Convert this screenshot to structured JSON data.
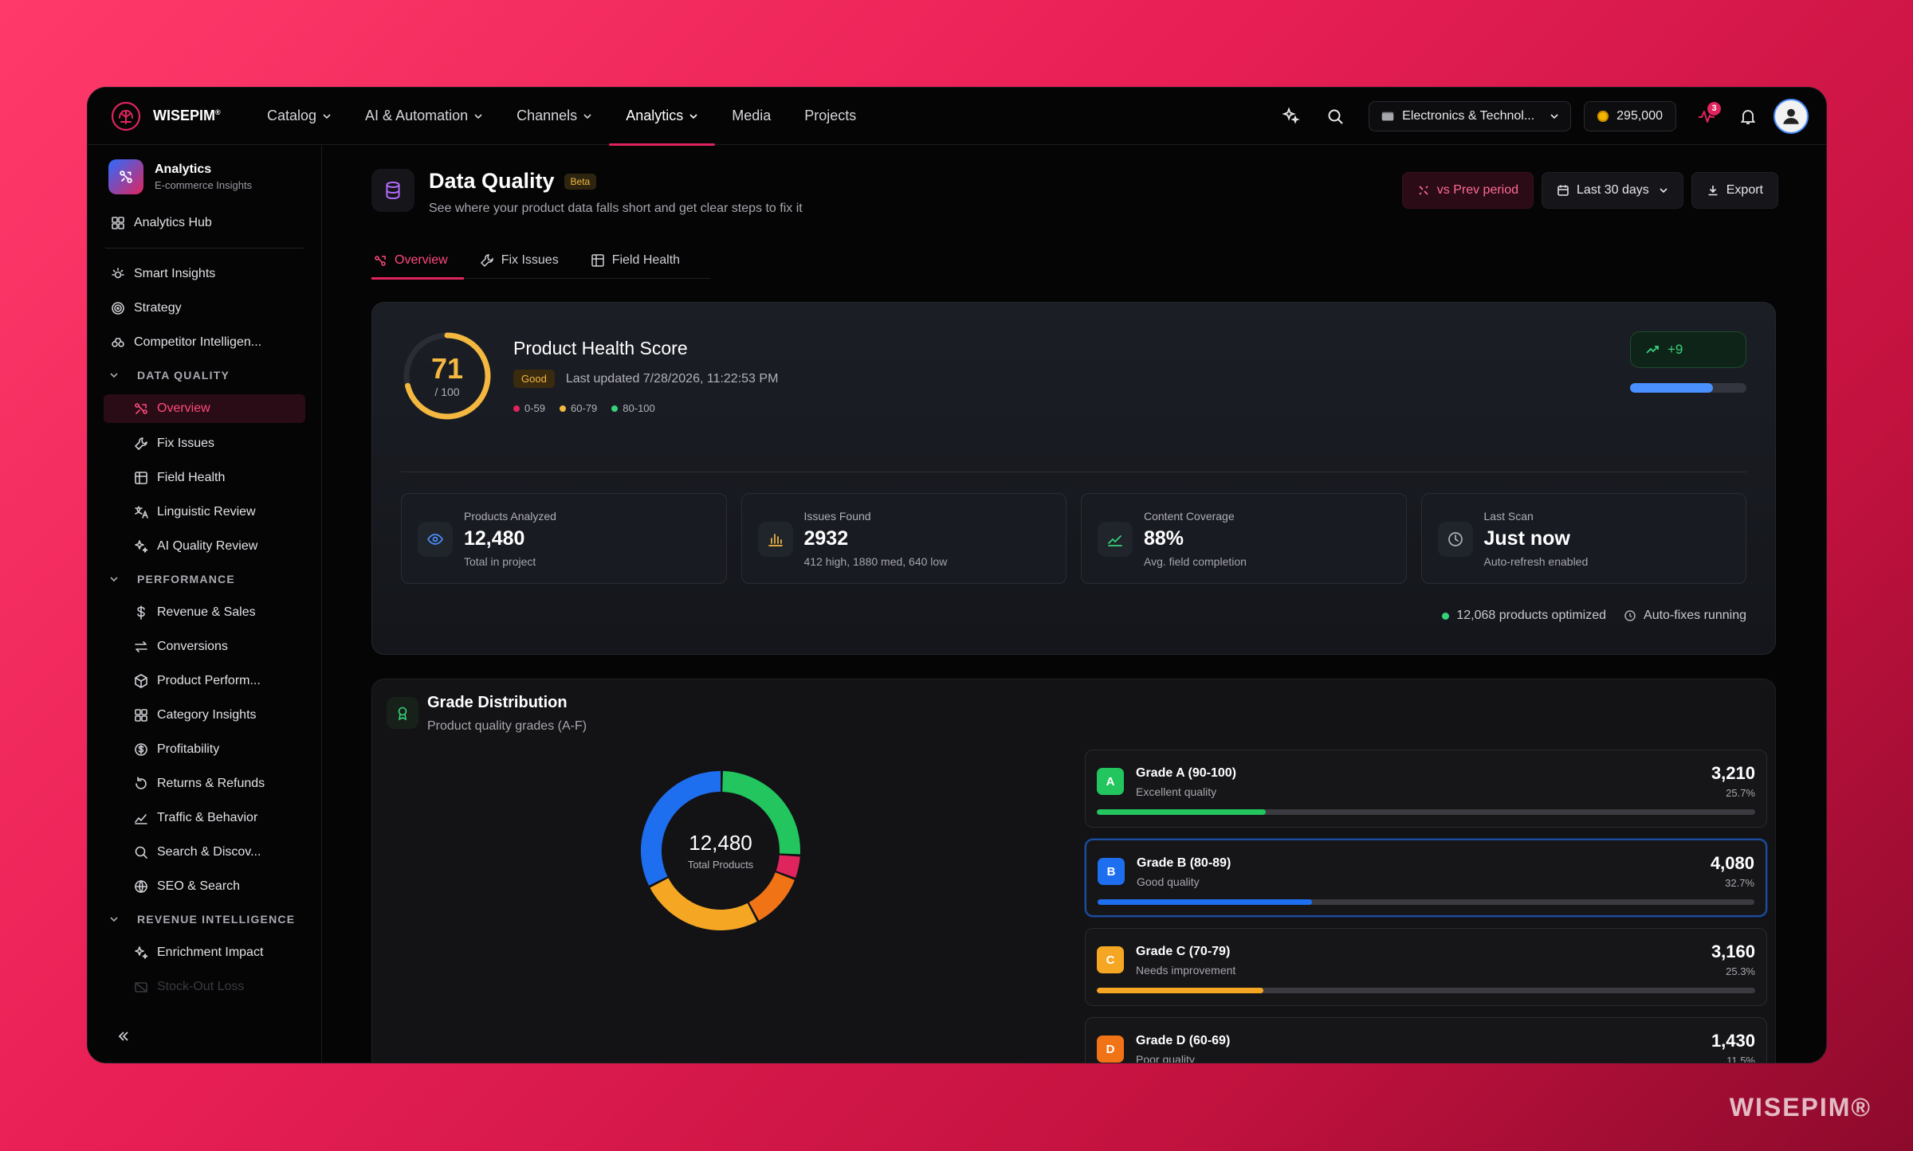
{
  "brand": {
    "name": "WISEPIM",
    "mark": "®",
    "watermark": "WISEPIM®"
  },
  "nav": [
    {
      "label": "Catalog",
      "dropdown": true
    },
    {
      "label": "AI & Automation",
      "dropdown": true
    },
    {
      "label": "Channels",
      "dropdown": true
    },
    {
      "label": "Analytics",
      "dropdown": true,
      "active": true
    },
    {
      "label": "Media",
      "dropdown": false
    },
    {
      "label": "Projects",
      "dropdown": false
    }
  ],
  "topbar": {
    "project_select": "Electronics & Technol...",
    "credits": "295,000",
    "activity_badge": "3"
  },
  "sidebar": {
    "title": "Analytics",
    "subtitle": "E-commerce Insights",
    "hub": "Analytics Hub",
    "top_items": [
      "Smart Insights",
      "Strategy",
      "Competitor Intelligen..."
    ],
    "sections": [
      {
        "label": "DATA QUALITY",
        "items": [
          "Overview",
          "Fix Issues",
          "Field Health",
          "Linguistic Review",
          "AI Quality Review"
        ]
      },
      {
        "label": "PERFORMANCE",
        "items": [
          "Revenue & Sales",
          "Conversions",
          "Product Perform...",
          "Category Insights",
          "Profitability",
          "Returns & Refunds",
          "Traffic & Behavior",
          "Search & Discov...",
          "SEO & Search"
        ]
      },
      {
        "label": "REVENUE INTELLIGENCE",
        "items": [
          "Enrichment Impact",
          "Stock-Out Loss"
        ]
      }
    ]
  },
  "page": {
    "title": "Data Quality",
    "badge": "Beta",
    "subtitle": "See where your product data falls short and get clear steps to fix it",
    "actions": {
      "compare": "vs Prev period",
      "range": "Last 30 days",
      "export": "Export"
    },
    "tabs": [
      "Overview",
      "Fix Issues",
      "Field Health"
    ]
  },
  "health": {
    "title": "Product Health Score",
    "score": "71",
    "score_max": "/ 100",
    "score_value": 71,
    "status": "Good",
    "updated": "Last updated 7/28/2026, 11:22:53 PM",
    "legend": [
      {
        "label": "0-59",
        "color": "#e0245e"
      },
      {
        "label": "60-79",
        "color": "#f4b840"
      },
      {
        "label": "80-100",
        "color": "#36d27a"
      }
    ],
    "trend": "+9",
    "trend_progress": 0.71,
    "stats": [
      {
        "label": "Products Analyzed",
        "value": "12,480",
        "desc": "Total in project",
        "icon": "eye-icon",
        "color": "#4a90ff"
      },
      {
        "label": "Issues Found",
        "value": "2932",
        "desc": "412 high, 1880 med, 640 low",
        "icon": "bar-chart-icon",
        "color": "#f4b840"
      },
      {
        "label": "Content Coverage",
        "value": "88%",
        "desc": "Avg. field completion",
        "icon": "trend-chart-icon",
        "color": "#36d27a"
      },
      {
        "label": "Last Scan",
        "value": "Just now",
        "desc": "Auto-refresh enabled",
        "icon": "clock-icon",
        "color": "#b0b0b7"
      }
    ],
    "optimized": "12,068 products optimized",
    "autofix": "Auto-fixes running"
  },
  "grades": {
    "title": "Grade Distribution",
    "subtitle": "Product quality grades (A-F)",
    "total": "12,480",
    "total_label": "Total Products",
    "items": [
      {
        "letter": "A",
        "name": "Grade A (90-100)",
        "desc": "Excellent quality",
        "count": "3,210",
        "pct": "25.7%",
        "value": 3210,
        "color": "#22c55e"
      },
      {
        "letter": "B",
        "name": "Grade B (80-89)",
        "desc": "Good quality",
        "count": "4,080",
        "pct": "32.7%",
        "value": 4080,
        "color": "#1e6ff0"
      },
      {
        "letter": "C",
        "name": "Grade C (70-79)",
        "desc": "Needs improvement",
        "count": "3,160",
        "pct": "25.3%",
        "value": 3160,
        "color": "#f5a623"
      },
      {
        "letter": "D",
        "name": "Grade D (60-69)",
        "desc": "Poor quality",
        "count": "1,430",
        "pct": "11.5%",
        "value": 1430,
        "color": "#f07316"
      }
    ],
    "donut_segments": [
      {
        "value": 3210,
        "color": "#22c55e"
      },
      {
        "value": 600,
        "color": "#e0245e"
      },
      {
        "value": 1430,
        "color": "#f07316"
      },
      {
        "value": 3160,
        "color": "#f5a623"
      },
      {
        "value": 4080,
        "color": "#1e6ff0"
      }
    ]
  }
}
